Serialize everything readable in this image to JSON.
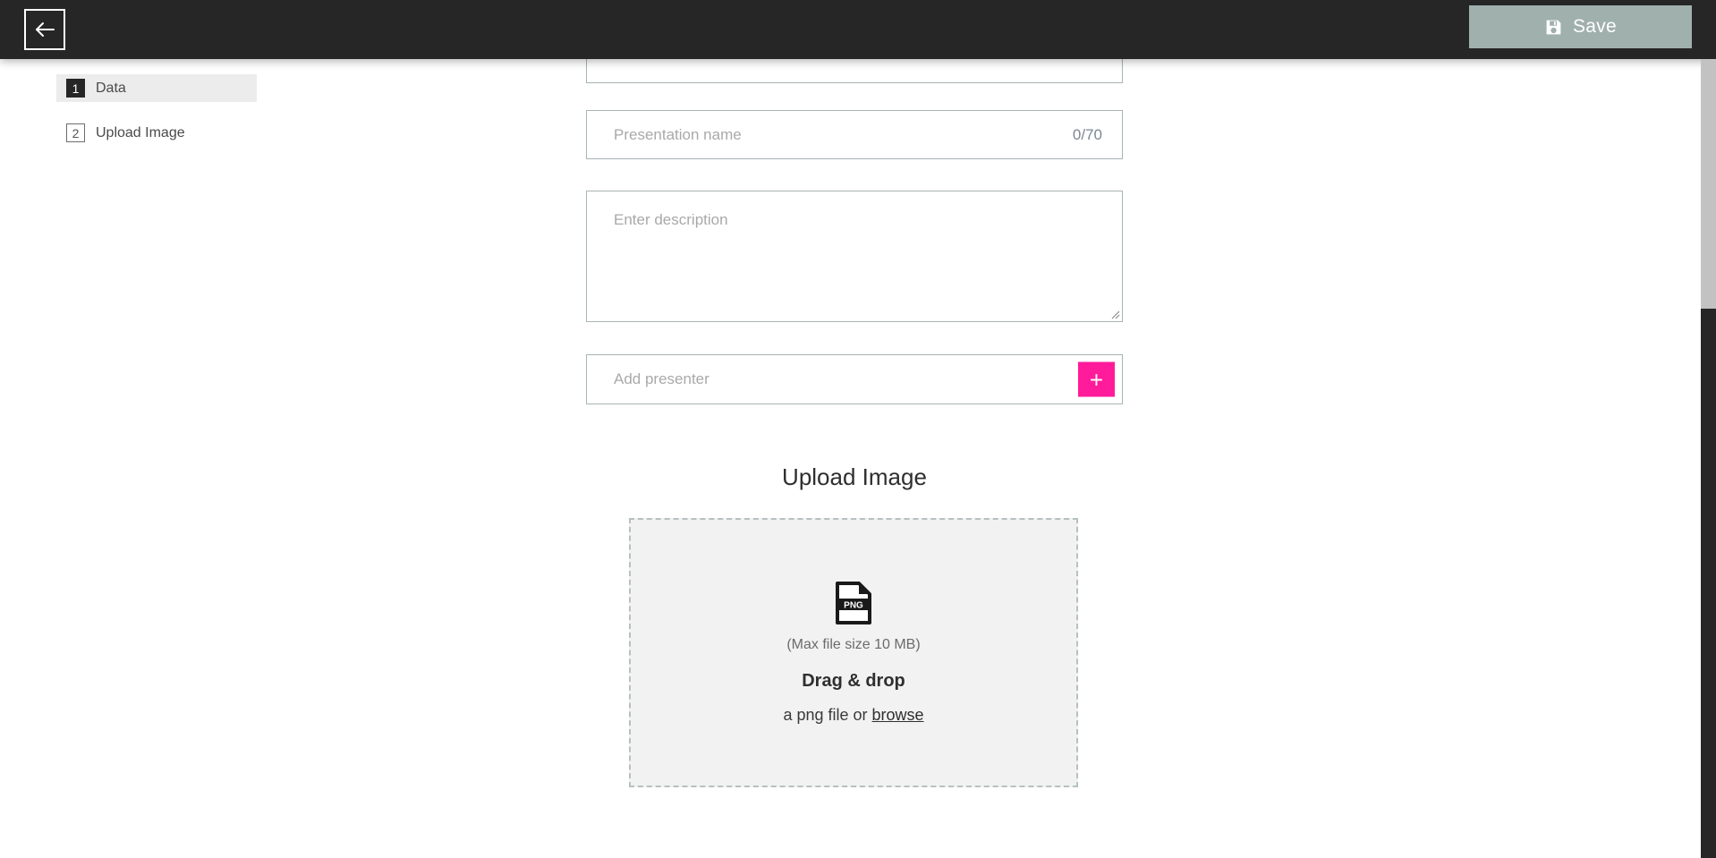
{
  "header": {
    "back_label": "back-arrow",
    "save_label": "Save",
    "save_icon": "floppy-disk-icon",
    "background": "#262626",
    "save_color": "#a0b0ad"
  },
  "sidebar": {
    "items": [
      {
        "number": "1",
        "label": "Data",
        "active": true
      },
      {
        "number": "2",
        "label": "Upload Image",
        "active": false
      }
    ]
  },
  "form": {
    "cut_field": {
      "placeholder": "",
      "value": ""
    },
    "name_field": {
      "placeholder": "Presentation name",
      "value": "",
      "counter": "0/70"
    },
    "description_field": {
      "placeholder": "Enter description",
      "value": ""
    },
    "presenter_field": {
      "placeholder": "Add presenter",
      "value": "",
      "add_button_label": "+",
      "add_button_color": "#ff1b9a"
    }
  },
  "upload": {
    "title": "Upload Image",
    "file_icon": "png-file-icon",
    "max_size": "(Max file size 10 MB)",
    "drag_drop": "Drag & drop",
    "browse_prefix": "a png file or ",
    "browse_link": "browse"
  }
}
